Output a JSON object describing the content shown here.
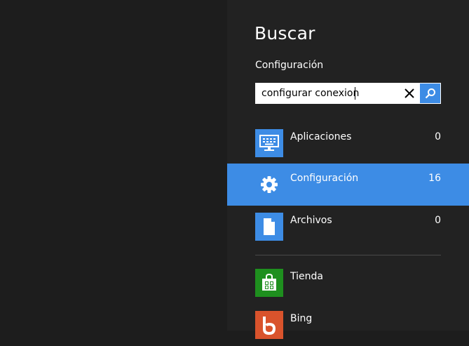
{
  "pane": {
    "title": "Buscar",
    "scope": "Configuración"
  },
  "search": {
    "value": "configurar conexion",
    "clear_icon": "close-icon",
    "search_icon": "search-icon"
  },
  "results": [
    {
      "label": "Aplicaciones",
      "count": "0",
      "icon": "apps-icon",
      "selected": false
    },
    {
      "label": "Configuración",
      "count": "16",
      "icon": "gear-icon",
      "selected": true
    },
    {
      "label": "Archivos",
      "count": "0",
      "icon": "file-icon",
      "selected": false
    }
  ],
  "apps": [
    {
      "label": "Tienda",
      "icon": "store-icon"
    },
    {
      "label": "Bing",
      "icon": "bing-icon"
    }
  ],
  "colors": {
    "accent": "#3d8ce5",
    "pane_bg": "#222222",
    "store_green": "#1e8f1e",
    "bing_orange": "#d9532c"
  }
}
